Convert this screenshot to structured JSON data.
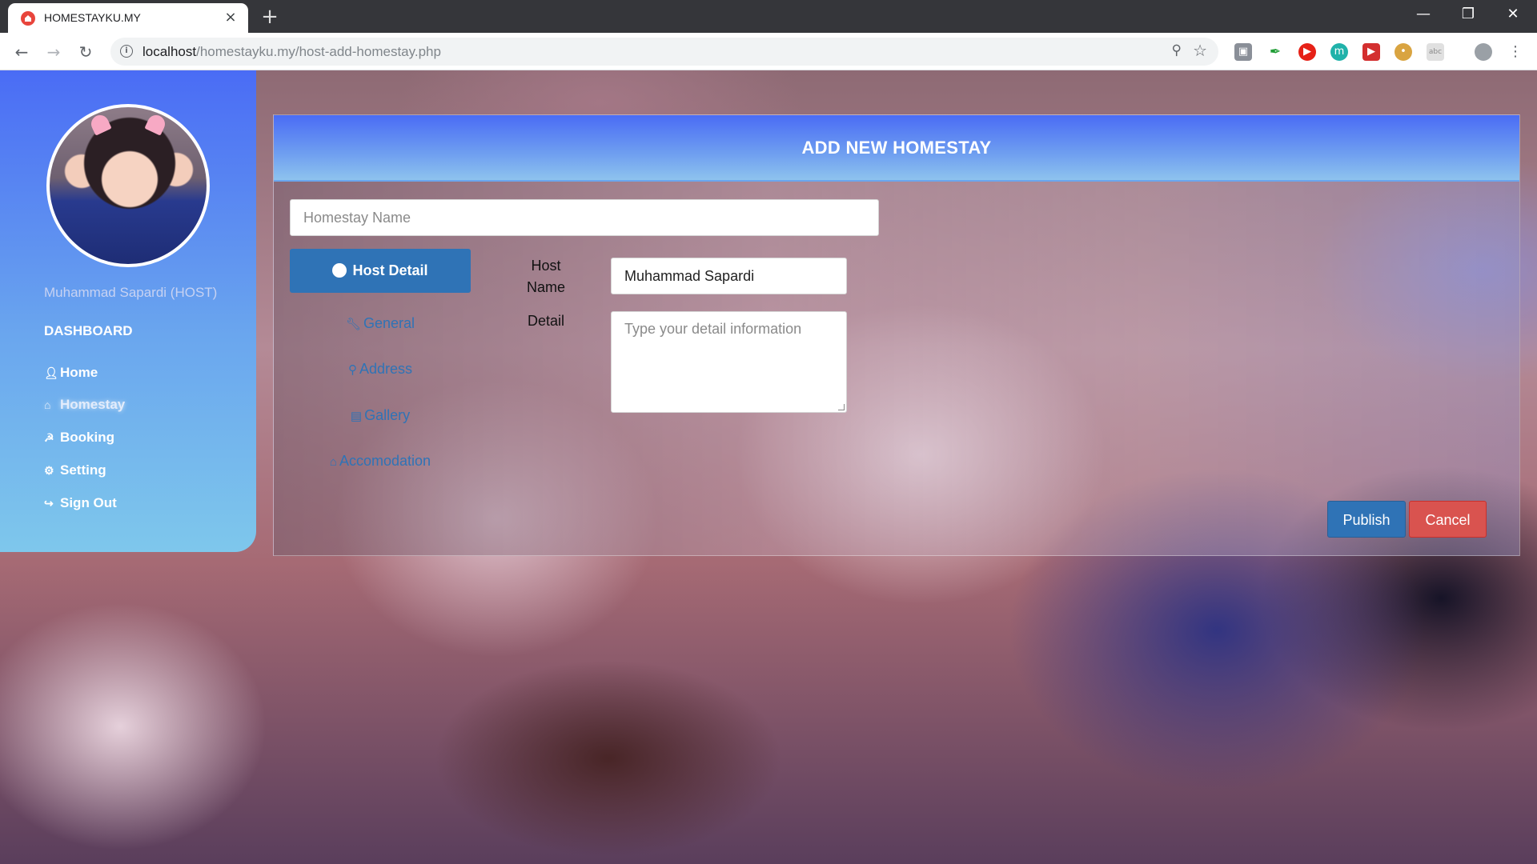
{
  "browser": {
    "tab_title": "HOMESTAYKU.MY",
    "tab_close": "×",
    "new_tab": "+",
    "url_host": "localhost",
    "url_path": "/homestayku.my/host-add-homestay.php",
    "window_controls": [
      "minimize-icon",
      "restore-icon",
      "close-icon"
    ],
    "extensions": [
      "profile-card-icon",
      "pen-icon",
      "youtube-icon",
      "m-icon",
      "video-icon",
      "cookie-icon",
      "extension-icon"
    ]
  },
  "sidebar": {
    "host_name": "Muhammad Sapardi (HOST)",
    "section": "DASHBOARD",
    "items": [
      {
        "label": "Home",
        "icon": "user-icon"
      },
      {
        "label": "Homestay",
        "icon": "home-icon",
        "active": true
      },
      {
        "label": "Booking",
        "icon": "cart-icon"
      },
      {
        "label": "Setting",
        "icon": "gear-icon"
      },
      {
        "label": "Sign Out",
        "icon": "sign-out-icon"
      }
    ]
  },
  "form": {
    "title": "ADD NEW HOMESTAY",
    "homestay_name_placeholder": "Homestay Name",
    "tabs": [
      {
        "label": "Host Detail",
        "icon": "user-circle-icon",
        "active": true
      },
      {
        "label": "General",
        "icon": "wrench-icon"
      },
      {
        "label": "Address",
        "icon": "map-marker-icon"
      },
      {
        "label": "Gallery",
        "icon": "image-icon"
      },
      {
        "label": "Accomodation",
        "icon": "home-icon"
      }
    ],
    "host_name_label_line1": "Host",
    "host_name_label_line2": "Name",
    "host_name_value": "Muhammad Sapardi",
    "detail_label": "Detail",
    "detail_placeholder": "Type your detail information",
    "publish_label": "Publish",
    "cancel_label": "Cancel"
  },
  "colors": {
    "primary": "#2f73b6",
    "danger": "#d9534f",
    "header_gradient_start": "#4a6cf5",
    "header_gradient_end": "#8ec3ee"
  }
}
